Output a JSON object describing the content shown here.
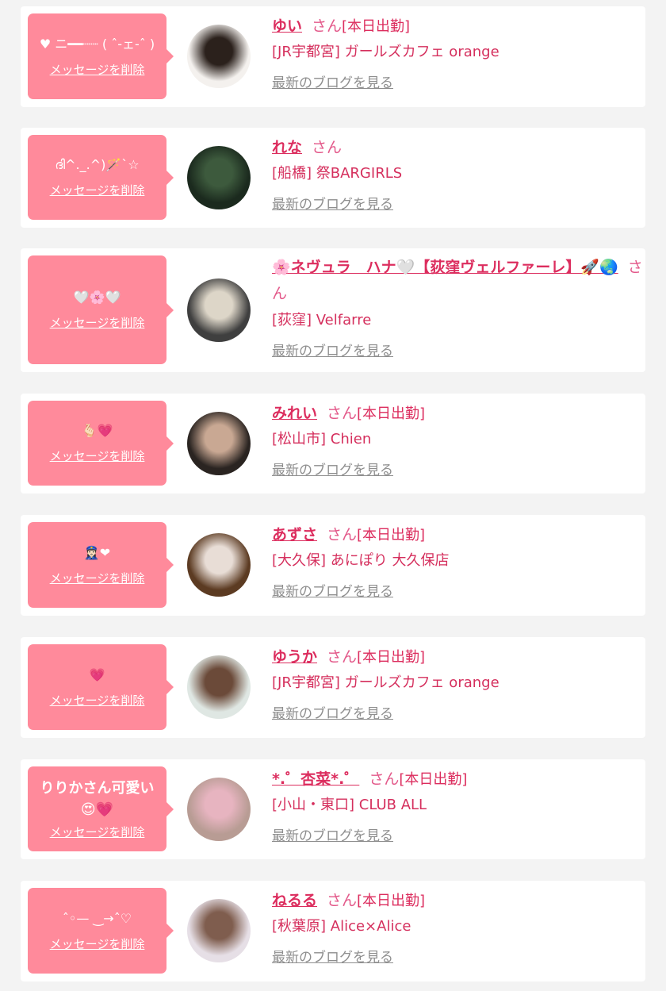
{
  "labels": {
    "delete": "メッセージを削除",
    "san": "さん",
    "blog": "最新のブログを見る"
  },
  "entries": [
    {
      "message": "♥︎ ニ━━┈┈ ( ˆ-ェ-ˆ )",
      "name": "ゆい",
      "badge": "[本日出勤]",
      "shop": "[JR宇都宮] ガールズカフェ orange",
      "avatar_colors": [
        "#f4f1ee",
        "#2b211c"
      ]
    },
    {
      "message": "ദി^._.^)🪄`☆",
      "name": "れな",
      "badge": "",
      "shop": "[船橋] 祭BARGIRLS",
      "avatar_colors": [
        "#1b2a1e",
        "#3d5a3d"
      ]
    },
    {
      "message": "🤍🌸🤍",
      "name": "🌸ネヴュラ　ハナ🤍【荻窪ヴェルファーレ】🚀🌏",
      "badge": "",
      "shop": "[荻窪] Velfarre",
      "avatar_colors": [
        "#3f3f3f",
        "#ddd6c8"
      ]
    },
    {
      "message": "🫰🏻💗",
      "name": "みれい",
      "badge": "[本日出勤]",
      "shop": "[松山市] Chien",
      "avatar_colors": [
        "#2a2421",
        "#c9a893"
      ]
    },
    {
      "message": "👮🏻‍♀️❤︎",
      "name": "あずさ",
      "badge": "[本日出勤]",
      "shop": "[大久保] あにぽり 大久保店",
      "avatar_colors": [
        "#5c3b22",
        "#e8ddd6"
      ]
    },
    {
      "message": "💗",
      "name": "ゆうか",
      "badge": "[本日出勤]",
      "shop": "[JR宇都宮] ガールズカフェ orange",
      "avatar_colors": [
        "#dfe7e3",
        "#6b4a39"
      ]
    },
    {
      "message": "りりかさん可愛い😍💗",
      "name": "*.゜杏菜*.゜",
      "badge": "[本日出勤]",
      "shop": "[小山・東口] CLUB ALL",
      "avatar_colors": [
        "#b89c94",
        "#e7b4c0"
      ]
    },
    {
      "message": "ˆ◦— ‿→ˆ♡",
      "name": "ねるる",
      "badge": "[本日出勤]",
      "shop": "[秋葉原] Alice×Alice",
      "avatar_colors": [
        "#e6dfe6",
        "#7f5d4e"
      ]
    }
  ]
}
